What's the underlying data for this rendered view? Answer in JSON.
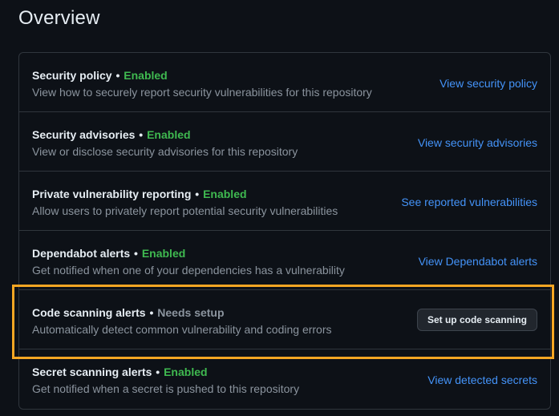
{
  "header": {
    "title": "Overview"
  },
  "features": [
    {
      "name": "Security policy",
      "separator": "•",
      "status": "Enabled",
      "description": "View how to securely report security vulnerabilities for this repository",
      "action": "View security policy"
    },
    {
      "name": "Security advisories",
      "separator": "•",
      "status": "Enabled",
      "description": "View or disclose security advisories for this repository",
      "action": "View security advisories"
    },
    {
      "name": "Private vulnerability reporting",
      "separator": "•",
      "status": "Enabled",
      "description": "Allow users to privately report potential security vulnerabilities",
      "action": "See reported vulnerabilities"
    },
    {
      "name": "Dependabot alerts",
      "separator": "•",
      "status": "Enabled",
      "description": "Get notified when one of your dependencies has a vulnerability",
      "action": "View Dependabot alerts"
    },
    {
      "name": "Code scanning alerts",
      "separator": "•",
      "status": "Needs setup",
      "description": "Automatically detect common vulnerability and coding errors",
      "action": "Set up code scanning"
    },
    {
      "name": "Secret scanning alerts",
      "separator": "•",
      "status": "Enabled",
      "description": "Get notified when a secret is pushed to this repository",
      "action": "View detected secrets"
    }
  ],
  "colors": {
    "background": "#0d1117",
    "border": "#30363d",
    "enabled": "#3fb950",
    "needs_setup": "#8b949e",
    "link": "#4493f8",
    "highlight": "#f5a623"
  }
}
